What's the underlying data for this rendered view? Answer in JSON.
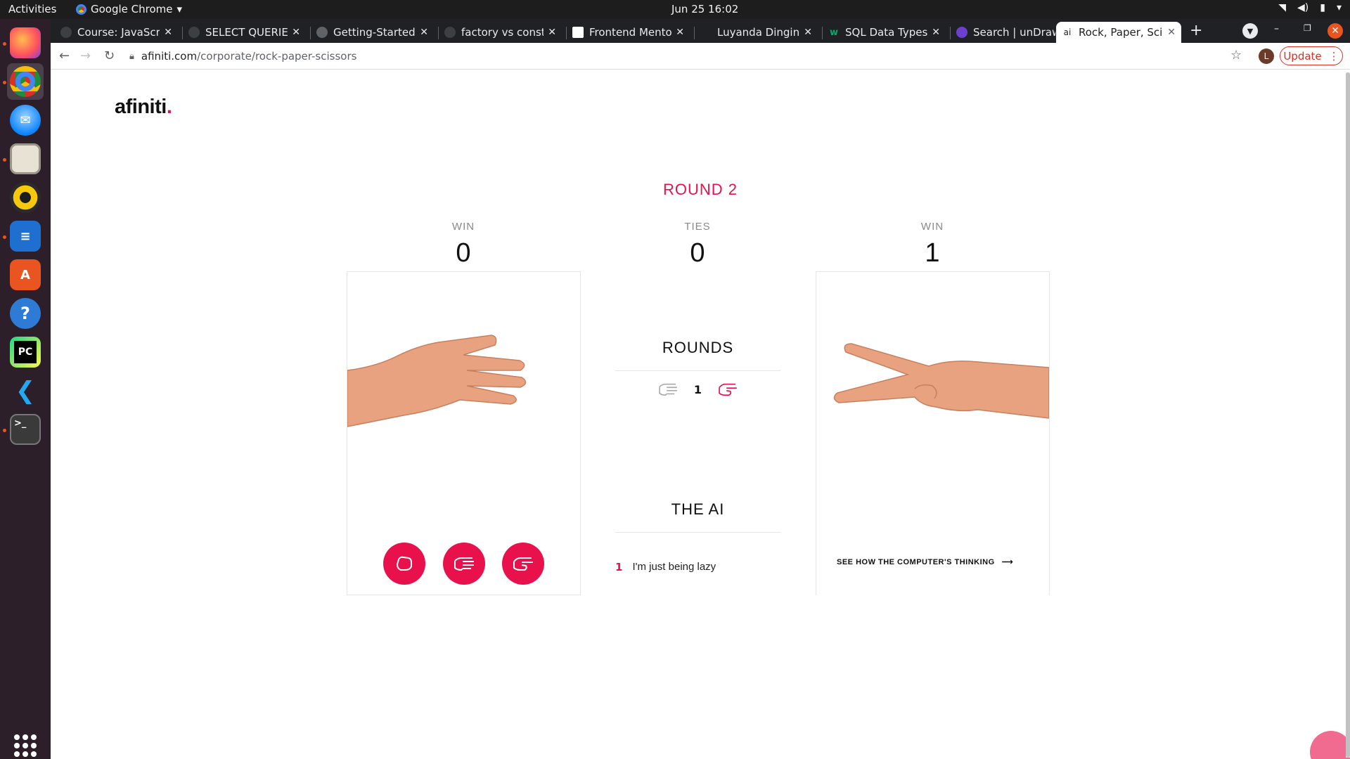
{
  "system": {
    "activities": "Activities",
    "app_name": "Google Chrome",
    "clock": "Jun 25  16:02"
  },
  "dock": {
    "items": [
      "firefox",
      "chrome",
      "thunderbird",
      "files",
      "rhythmbox",
      "writer",
      "software-center",
      "help",
      "pycharm",
      "vscode",
      "terminal"
    ]
  },
  "tabs": [
    {
      "label": "Course: JavaScri",
      "fav_color": "#3c4043"
    },
    {
      "label": "SELECT QUERIES",
      "fav_color": "#3c4043"
    },
    {
      "label": "Getting-Started-",
      "fav_color": "#5f6368"
    },
    {
      "label": "factory vs constr",
      "fav_color": "#3c4043"
    },
    {
      "label": "Frontend Mento",
      "fav_color": "#ffffff"
    },
    {
      "label": "Luyanda Dingin",
      "fav_color": "#202124"
    },
    {
      "label": "SQL Data Types f",
      "fav_color": "#04aa6d"
    },
    {
      "label": "Search | unDraw",
      "fav_color": "#6c3fcf"
    },
    {
      "label": "Rock, Paper, Scis",
      "fav_color": "#ffffff",
      "fav_text": "ai",
      "active": true
    }
  ],
  "toolbar": {
    "url_host": "afiniti.com",
    "url_path": "/corporate/rock-paper-scissors",
    "profile_initial": "L",
    "update_label": "Update"
  },
  "page": {
    "logo": "afiniti",
    "logo_dot": ".",
    "round_title": "ROUND 2",
    "scores": [
      {
        "label": "WIN",
        "value": "0"
      },
      {
        "label": "TIES",
        "value": "0"
      },
      {
        "label": "WIN",
        "value": "1"
      }
    ],
    "rounds_title": "ROUNDS",
    "rounds": [
      {
        "number": "1",
        "player": "paper",
        "ai": "scissors"
      }
    ],
    "ai_title": "THE AI",
    "ai_log": [
      {
        "number": "1",
        "text": "I'm just being lazy"
      }
    ],
    "see_link": "SEE HOW THE COMPUTER'S THINKING",
    "player_hand": "paper",
    "ai_hand": "scissors",
    "moves": [
      "rock",
      "paper",
      "scissors"
    ]
  },
  "colors": {
    "accent": "#e8114b",
    "chrome_dark": "#202124",
    "dock_bg": "#2c1f2a"
  }
}
